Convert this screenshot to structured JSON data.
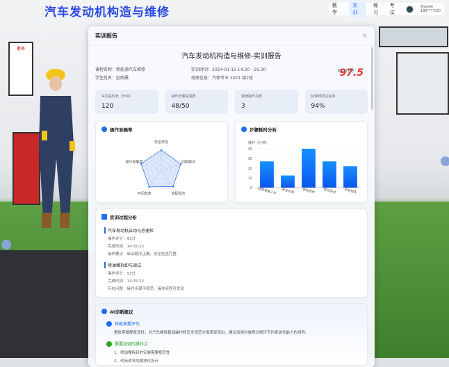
{
  "app": {
    "title": "汽车发动机构造与维修",
    "nav": [
      "教学",
      "实训",
      "练习",
      "考试"
    ],
    "active_nav": "实训",
    "user": {
      "name": "Xiaowe",
      "phone": "180****120"
    },
    "poster": "素养"
  },
  "modal": {
    "title": "实训报告",
    "close": "×",
    "report_title": "汽车发动机构造与维修-实训报告",
    "info": {
      "course": "课程名称：新能源汽车维修",
      "student": "学生姓名：赵雨晨",
      "time": "实训时间：2024-01-15 14:30 - 16:30",
      "class": "班级信息：汽修专业 2021 级2班",
      "score_label": "综合评分：",
      "score": "97.5"
    },
    "stats": [
      {
        "label": "实训总时长（分钟）",
        "value": "120"
      },
      {
        "label": "操作步骤完成数",
        "value": "48/50"
      },
      {
        "label": "错误操作次数",
        "value": "3"
      },
      {
        "label": "标准规范达标率",
        "value": "94%"
      }
    ],
    "radar_title": "操作准确率",
    "bar_title": "步骤耗时分析",
    "process": {
      "title": "实训过程分析",
      "steps": [
        {
          "name": "汽车发动机启动与怠速检",
          "score": "操作评分：93分",
          "time": "完成时间：14:35:22",
          "note": "操作要点：启动顺序正确，安全检查完整"
        },
        {
          "name": "喷油嘴拆卸与调试",
          "score": "操作评分：93分",
          "time": "完成时间：14:35:22",
          "note": "存在问题：操作步骤不规范、操作流程可优化"
        }
      ]
    },
    "ai": {
      "title": "AI诊断建议",
      "s1": "技能掌握评估",
      "s1_text": "整体掌握程度良好，对汽车维修基础操作和安全规范方面表现突出。建议加强对故障诊断环节的系统化能力的培养。",
      "s2": "需要加强的操作点",
      "s2_items": [
        "1、喷油嘴拆卸的安装需要规范性",
        "2、代码调写的模块化设计"
      ]
    }
  },
  "chart_data": [
    {
      "type": "radar",
      "title": "操作准确率",
      "categories": [
        "安全规范",
        "问题解决",
        "流程规范",
        "时间效率",
        "操作准确度"
      ],
      "values": [
        90,
        92,
        90,
        92,
        95
      ],
      "max": 100
    },
    {
      "type": "bar",
      "title": "步骤耗时分析",
      "ylabel": "耗时（分钟）",
      "categories": [
        "前期准备工作",
        "安全检查",
        "拆卸部件",
        "调试测试",
        "总结报告"
      ],
      "values": [
        27,
        12.5,
        40,
        27,
        22
      ],
      "ylim": [
        0,
        40
      ],
      "yticks": [
        0,
        10,
        20,
        30,
        40
      ]
    }
  ],
  "colors": {
    "accent": "#1e6ff0",
    "score": "#e8322f",
    "title": "#2c4be0"
  }
}
